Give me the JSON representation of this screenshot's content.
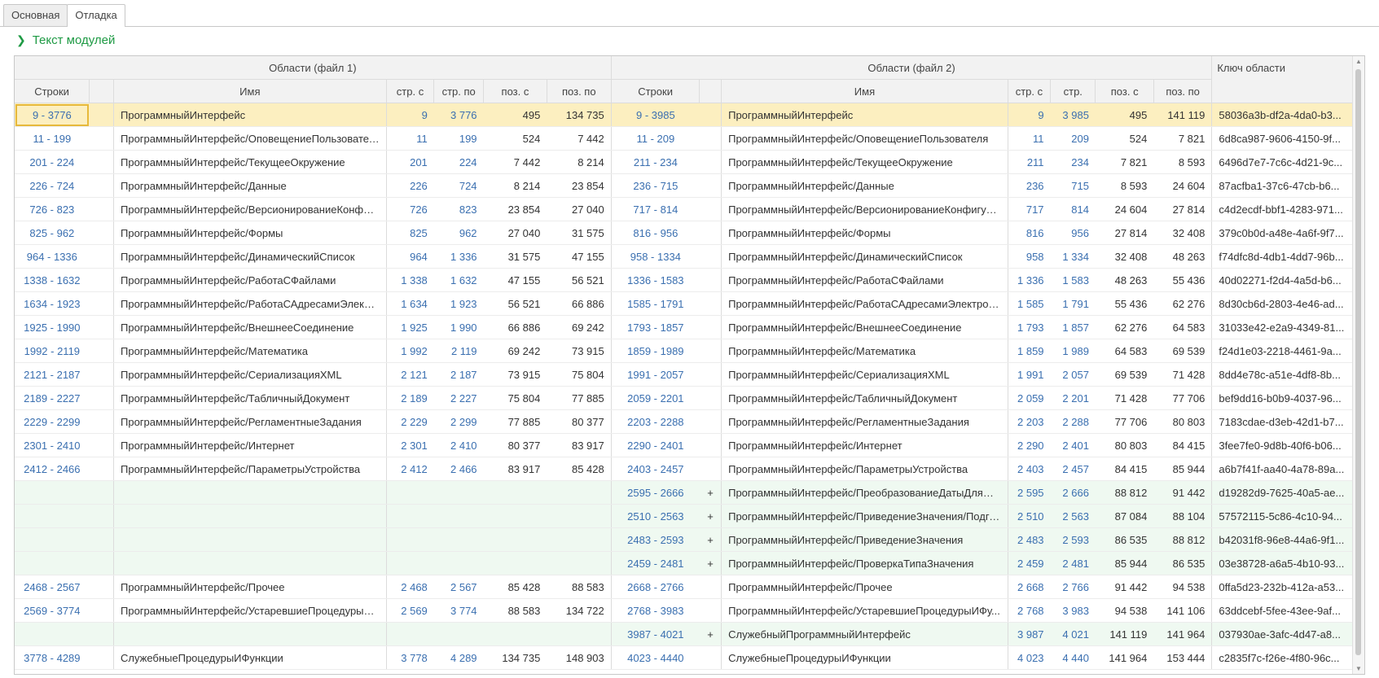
{
  "tabs": [
    {
      "label": "Основная",
      "active": false
    },
    {
      "label": "Отладка",
      "active": true
    }
  ],
  "group_title": "Текст модулей",
  "grid": {
    "header_groups": {
      "file1": "Области (файл 1)",
      "file2": "Области (файл 2)",
      "key": "Ключ области"
    },
    "columns": {
      "lines1": "Строки",
      "name1": "Имя",
      "from1": "стр. с",
      "to1": "стр. по",
      "pos_from1": "поз. с",
      "pos_to1": "поз. по",
      "lines2": "Строки",
      "name2": "Имя",
      "from2": "стр. с",
      "to2": "стр.",
      "pos_from2": "поз. с",
      "pos_to2": "поз. по"
    },
    "rows": [
      {
        "lines1": "9 - 3776",
        "name1": "ПрограммныйИнтерфейс",
        "from1": "9",
        "to1": "3 776",
        "pos_from1": "495",
        "pos_to1": "134 735",
        "lines2": "9 - 3985",
        "mark": "",
        "name2": "ПрограммныйИнтерфейс",
        "from2": "9",
        "to2": "3 985",
        "pos_from2": "495",
        "pos_to2": "141 119",
        "key": "58036a3b-df2a-4da0-b3...",
        "state": "selected"
      },
      {
        "lines1": "11 - 199",
        "name1": "ПрограммныйИнтерфейс/ОповещениеПользователя",
        "from1": "11",
        "to1": "199",
        "pos_from1": "524",
        "pos_to1": "7 442",
        "lines2": "11 - 209",
        "mark": "",
        "name2": "ПрограммныйИнтерфейс/ОповещениеПользователя",
        "from2": "11",
        "to2": "209",
        "pos_from2": "524",
        "pos_to2": "7 821",
        "key": "6d8ca987-9606-4150-9f...",
        "state": ""
      },
      {
        "lines1": "201 - 224",
        "name1": "ПрограммныйИнтерфейс/ТекущееОкружение",
        "from1": "201",
        "to1": "224",
        "pos_from1": "7 442",
        "pos_to1": "8 214",
        "lines2": "211 - 234",
        "mark": "",
        "name2": "ПрограммныйИнтерфейс/ТекущееОкружение",
        "from2": "211",
        "to2": "234",
        "pos_from2": "7 821",
        "pos_to2": "8 593",
        "key": "6496d7e7-7c6c-4d21-9c...",
        "state": ""
      },
      {
        "lines1": "226 - 724",
        "name1": "ПрограммныйИнтерфейс/Данные",
        "from1": "226",
        "to1": "724",
        "pos_from1": "8 214",
        "pos_to1": "23 854",
        "lines2": "236 - 715",
        "mark": "",
        "name2": "ПрограммныйИнтерфейс/Данные",
        "from2": "236",
        "to2": "715",
        "pos_from2": "8 593",
        "pos_to2": "24 604",
        "key": "87acfba1-37c6-47cb-b6...",
        "state": ""
      },
      {
        "lines1": "726 - 823",
        "name1": "ПрограммныйИнтерфейс/ВерсионированиеКонфигу...",
        "from1": "726",
        "to1": "823",
        "pos_from1": "23 854",
        "pos_to1": "27 040",
        "lines2": "717 - 814",
        "mark": "",
        "name2": "ПрограммныйИнтерфейс/ВерсионированиеКонфигура...",
        "from2": "717",
        "to2": "814",
        "pos_from2": "24 604",
        "pos_to2": "27 814",
        "key": "c4d2ecdf-bbf1-4283-971...",
        "state": ""
      },
      {
        "lines1": "825 - 962",
        "name1": "ПрограммныйИнтерфейс/Формы",
        "from1": "825",
        "to1": "962",
        "pos_from1": "27 040",
        "pos_to1": "31 575",
        "lines2": "816 - 956",
        "mark": "",
        "name2": "ПрограммныйИнтерфейс/Формы",
        "from2": "816",
        "to2": "956",
        "pos_from2": "27 814",
        "pos_to2": "32 408",
        "key": "379c0b0d-a48e-4a6f-9f7...",
        "state": ""
      },
      {
        "lines1": "964 - 1336",
        "name1": "ПрограммныйИнтерфейс/ДинамическийСписок",
        "from1": "964",
        "to1": "1 336",
        "pos_from1": "31 575",
        "pos_to1": "47 155",
        "lines2": "958 - 1334",
        "mark": "",
        "name2": "ПрограммныйИнтерфейс/ДинамическийСписок",
        "from2": "958",
        "to2": "1 334",
        "pos_from2": "32 408",
        "pos_to2": "48 263",
        "key": "f74dfc8d-4db1-4dd7-96b...",
        "state": ""
      },
      {
        "lines1": "1338 - 1632",
        "name1": "ПрограммныйИнтерфейс/РаботаСФайлами",
        "from1": "1 338",
        "to1": "1 632",
        "pos_from1": "47 155",
        "pos_to1": "56 521",
        "lines2": "1336 - 1583",
        "mark": "",
        "name2": "ПрограммныйИнтерфейс/РаботаСФайлами",
        "from2": "1 336",
        "to2": "1 583",
        "pos_from2": "48 263",
        "pos_to2": "55 436",
        "key": "40d02271-f2d4-4a5d-b6...",
        "state": ""
      },
      {
        "lines1": "1634 - 1923",
        "name1": "ПрограммныйИнтерфейс/РаботаСАдресамиЭлектр...",
        "from1": "1 634",
        "to1": "1 923",
        "pos_from1": "56 521",
        "pos_to1": "66 886",
        "lines2": "1585 - 1791",
        "mark": "",
        "name2": "ПрограммныйИнтерфейс/РаботаСАдресамиЭлектрон...",
        "from2": "1 585",
        "to2": "1 791",
        "pos_from2": "55 436",
        "pos_to2": "62 276",
        "key": "8d30cb6d-2803-4e46-ad...",
        "state": ""
      },
      {
        "lines1": "1925 - 1990",
        "name1": "ПрограммныйИнтерфейс/ВнешнееСоединение",
        "from1": "1 925",
        "to1": "1 990",
        "pos_from1": "66 886",
        "pos_to1": "69 242",
        "lines2": "1793 - 1857",
        "mark": "",
        "name2": "ПрограммныйИнтерфейс/ВнешнееСоединение",
        "from2": "1 793",
        "to2": "1 857",
        "pos_from2": "62 276",
        "pos_to2": "64 583",
        "key": "31033e42-e2a9-4349-81...",
        "state": ""
      },
      {
        "lines1": "1992 - 2119",
        "name1": "ПрограммныйИнтерфейс/Математика",
        "from1": "1 992",
        "to1": "2 119",
        "pos_from1": "69 242",
        "pos_to1": "73 915",
        "lines2": "1859 - 1989",
        "mark": "",
        "name2": "ПрограммныйИнтерфейс/Математика",
        "from2": "1 859",
        "to2": "1 989",
        "pos_from2": "64 583",
        "pos_to2": "69 539",
        "key": "f24d1e03-2218-4461-9a...",
        "state": ""
      },
      {
        "lines1": "2121 - 2187",
        "name1": "ПрограммныйИнтерфейс/СериализацияXML",
        "from1": "2 121",
        "to1": "2 187",
        "pos_from1": "73 915",
        "pos_to1": "75 804",
        "lines2": "1991 - 2057",
        "mark": "",
        "name2": "ПрограммныйИнтерфейс/СериализацияXML",
        "from2": "1 991",
        "to2": "2 057",
        "pos_from2": "69 539",
        "pos_to2": "71 428",
        "key": "8dd4e78c-a51e-4df8-8b...",
        "state": ""
      },
      {
        "lines1": "2189 - 2227",
        "name1": "ПрограммныйИнтерфейс/ТабличныйДокумент",
        "from1": "2 189",
        "to1": "2 227",
        "pos_from1": "75 804",
        "pos_to1": "77 885",
        "lines2": "2059 - 2201",
        "mark": "",
        "name2": "ПрограммныйИнтерфейс/ТабличныйДокумент",
        "from2": "2 059",
        "to2": "2 201",
        "pos_from2": "71 428",
        "pos_to2": "77 706",
        "key": "bef9dd16-b0b9-4037-96...",
        "state": ""
      },
      {
        "lines1": "2229 - 2299",
        "name1": "ПрограммныйИнтерфейс/РегламентныеЗадания",
        "from1": "2 229",
        "to1": "2 299",
        "pos_from1": "77 885",
        "pos_to1": "80 377",
        "lines2": "2203 - 2288",
        "mark": "",
        "name2": "ПрограммныйИнтерфейс/РегламентныеЗадания",
        "from2": "2 203",
        "to2": "2 288",
        "pos_from2": "77 706",
        "pos_to2": "80 803",
        "key": "7183cdae-d3eb-42d1-b7...",
        "state": ""
      },
      {
        "lines1": "2301 - 2410",
        "name1": "ПрограммныйИнтерфейс/Интернет",
        "from1": "2 301",
        "to1": "2 410",
        "pos_from1": "80 377",
        "pos_to1": "83 917",
        "lines2": "2290 - 2401",
        "mark": "",
        "name2": "ПрограммныйИнтерфейс/Интернет",
        "from2": "2 290",
        "to2": "2 401",
        "pos_from2": "80 803",
        "pos_to2": "84 415",
        "key": "3fee7fe0-9d8b-40f6-b06...",
        "state": ""
      },
      {
        "lines1": "2412 - 2466",
        "name1": "ПрограммныйИнтерфейс/ПараметрыУстройства",
        "from1": "2 412",
        "to1": "2 466",
        "pos_from1": "83 917",
        "pos_to1": "85 428",
        "lines2": "2403 - 2457",
        "mark": "",
        "name2": "ПрограммныйИнтерфейс/ПараметрыУстройства",
        "from2": "2 403",
        "to2": "2 457",
        "pos_from2": "84 415",
        "pos_to2": "85 944",
        "key": "a6b7f41f-aa40-4a78-89a...",
        "state": ""
      },
      {
        "lines1": "",
        "name1": "",
        "from1": "",
        "to1": "",
        "pos_from1": "",
        "pos_to1": "",
        "lines2": "2595 - 2666",
        "mark": "+",
        "name2": "ПрограммныйИнтерфейс/ПреобразованиеДатыДляHTTP",
        "from2": "2 595",
        "to2": "2 666",
        "pos_from2": "88 812",
        "pos_to2": "91 442",
        "key": "d19282d9-7625-40a5-ae...",
        "state": "added"
      },
      {
        "lines1": "",
        "name1": "",
        "from1": "",
        "to1": "",
        "pos_from1": "",
        "pos_to1": "",
        "lines2": "2510 - 2563",
        "mark": "+",
        "name2": "ПрограммныйИнтерфейс/ПриведениеЗначения/Подго...",
        "from2": "2 510",
        "to2": "2 563",
        "pos_from2": "87 084",
        "pos_to2": "88 104",
        "key": "57572115-5c86-4c10-94...",
        "state": "added"
      },
      {
        "lines1": "",
        "name1": "",
        "from1": "",
        "to1": "",
        "pos_from1": "",
        "pos_to1": "",
        "lines2": "2483 - 2593",
        "mark": "+",
        "name2": "ПрограммныйИнтерфейс/ПриведениеЗначения",
        "from2": "2 483",
        "to2": "2 593",
        "pos_from2": "86 535",
        "pos_to2": "88 812",
        "key": "b42031f8-96e8-44a6-9f1...",
        "state": "added"
      },
      {
        "lines1": "",
        "name1": "",
        "from1": "",
        "to1": "",
        "pos_from1": "",
        "pos_to1": "",
        "lines2": "2459 - 2481",
        "mark": "+",
        "name2": "ПрограммныйИнтерфейс/ПроверкаТипаЗначения",
        "from2": "2 459",
        "to2": "2 481",
        "pos_from2": "85 944",
        "pos_to2": "86 535",
        "key": "03e38728-a6a5-4b10-93...",
        "state": "added"
      },
      {
        "lines1": "2468 - 2567",
        "name1": "ПрограммныйИнтерфейс/Прочее",
        "from1": "2 468",
        "to1": "2 567",
        "pos_from1": "85 428",
        "pos_to1": "88 583",
        "lines2": "2668 - 2766",
        "mark": "",
        "name2": "ПрограммныйИнтерфейс/Прочее",
        "from2": "2 668",
        "to2": "2 766",
        "pos_from2": "91 442",
        "pos_to2": "94 538",
        "key": "0ffa5d23-232b-412a-a53...",
        "state": ""
      },
      {
        "lines1": "2569 - 3774",
        "name1": "ПрограммныйИнтерфейс/УстаревшиеПроцедурыИ...",
        "from1": "2 569",
        "to1": "3 774",
        "pos_from1": "88 583",
        "pos_to1": "134 722",
        "lines2": "2768 - 3983",
        "mark": "",
        "name2": "ПрограммныйИнтерфейс/УстаревшиеПроцедурыИФу...",
        "from2": "2 768",
        "to2": "3 983",
        "pos_from2": "94 538",
        "pos_to2": "141 106",
        "key": "63ddcebf-5fee-43ee-9af...",
        "state": ""
      },
      {
        "lines1": "",
        "name1": "",
        "from1": "",
        "to1": "",
        "pos_from1": "",
        "pos_to1": "",
        "lines2": "3987 - 4021",
        "mark": "+",
        "name2": "СлужебныйПрограммныйИнтерфейс",
        "from2": "3 987",
        "to2": "4 021",
        "pos_from2": "141 119",
        "pos_to2": "141 964",
        "key": "037930ae-3afc-4d47-a8...",
        "state": "added"
      },
      {
        "lines1": "3778 - 4289",
        "name1": "СлужебныеПроцедурыИФункции",
        "from1": "3 778",
        "to1": "4 289",
        "pos_from1": "134 735",
        "pos_to1": "148 903",
        "lines2": "4023 - 4440",
        "mark": "",
        "name2": "СлужебныеПроцедурыИФункции",
        "from2": "4 023",
        "to2": "4 440",
        "pos_from2": "141 964",
        "pos_to2": "153 444",
        "key": "c2835f7c-f26e-4f80-96c...",
        "state": ""
      }
    ]
  }
}
